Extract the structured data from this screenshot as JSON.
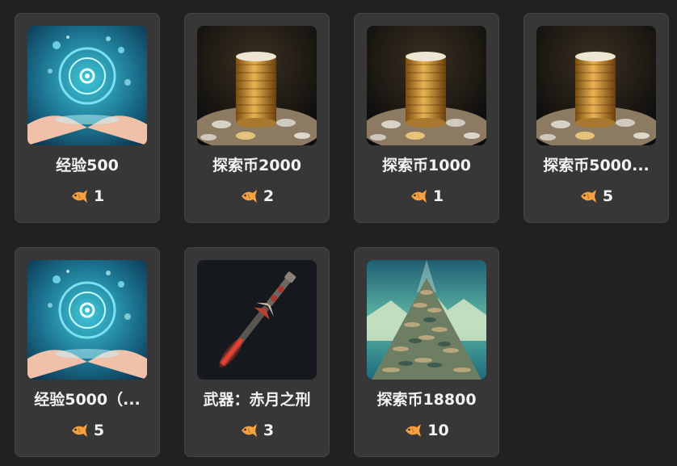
{
  "products": [
    {
      "title": "经验500",
      "price": "1",
      "image": "hands-orb"
    },
    {
      "title": "探索币2000",
      "price": "2",
      "image": "coin-stack"
    },
    {
      "title": "探索币1000",
      "price": "1",
      "image": "coin-stack"
    },
    {
      "title": "探索币5000...",
      "price": "5",
      "image": "coin-stack"
    },
    {
      "title": "经验5000（...",
      "price": "5",
      "image": "hands-orb"
    },
    {
      "title": "武器：赤月之刑",
      "price": "3",
      "image": "crimson-sword"
    },
    {
      "title": "探索币18800",
      "price": "10",
      "image": "coin-mountain"
    }
  ],
  "currency_icon": "fish-icon",
  "colors": {
    "background": "#212121",
    "card": "#373737",
    "text": "#f2f2f2",
    "fish": "#f5a142"
  }
}
